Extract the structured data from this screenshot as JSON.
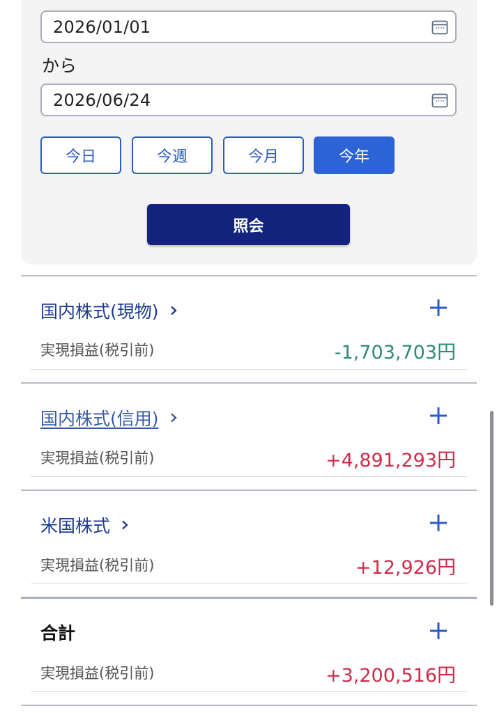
{
  "date_range": {
    "from": "2026/01/01",
    "connector": "から",
    "to": "2026/06/24"
  },
  "quick_ranges": [
    {
      "label": "今日",
      "active": false
    },
    {
      "label": "今週",
      "active": false
    },
    {
      "label": "今月",
      "active": false
    },
    {
      "label": "今年",
      "active": true
    }
  ],
  "search_button": "照会",
  "colors": {
    "accent": "#2c64d6",
    "primary_dark": "#13237e",
    "loss": "#2e8a76",
    "gain": "#cc2d4b"
  },
  "categories": [
    {
      "title": "国内株式(現物)",
      "pl_label": "実現損益(税引前)",
      "pl_value": "-1,703,703円",
      "sign": "negative",
      "expand_icon": "plus-icon"
    },
    {
      "title": "国内株式(信用)",
      "pl_label": "実現損益(税引前)",
      "pl_value": "+4,891,293円",
      "sign": "positive",
      "expand_icon": "plus-icon"
    },
    {
      "title": "米国株式",
      "pl_label": "実現損益(税引前)",
      "pl_value": "+12,926円",
      "sign": "positive",
      "expand_icon": "plus-icon"
    }
  ],
  "total": {
    "title": "合計",
    "pl_label": "実現損益(税引前)",
    "pl_value": "+3,200,516円",
    "sign": "positive",
    "expand_icon": "plus-icon"
  }
}
